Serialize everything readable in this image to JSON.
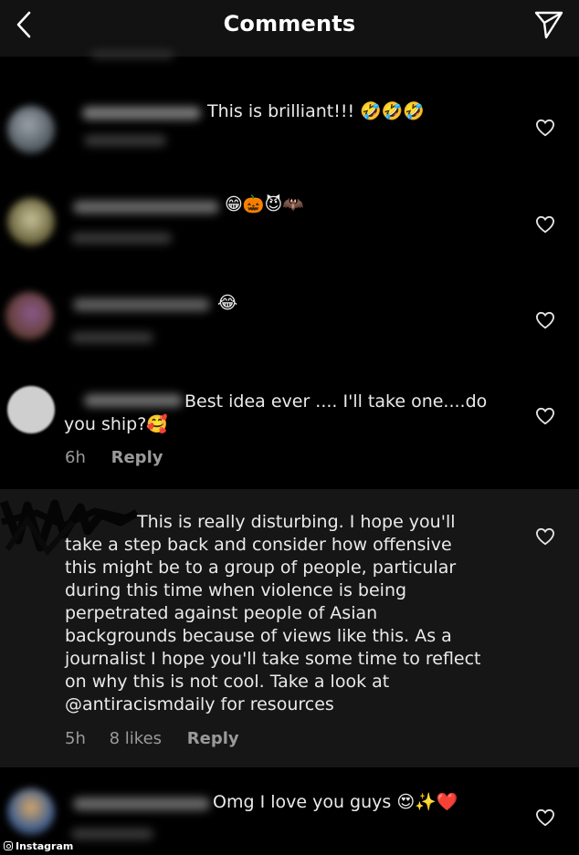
{
  "header": {
    "title": "Comments",
    "back_icon": "chevron-left-icon",
    "share_icon": "paper-plane-icon"
  },
  "comments": [
    {
      "text_lines": [
        "This is brilliant!!! 🤣🤣🤣"
      ],
      "time": "",
      "likes": "",
      "reply": ""
    },
    {
      "text_lines": [
        "😁🎃😈🦇"
      ],
      "time": "",
      "likes": "",
      "reply": ""
    },
    {
      "text_lines": [
        "😂"
      ],
      "time": "",
      "likes": "",
      "reply": ""
    },
    {
      "text_lines": [
        "Best idea ever .... I'll take one....do",
        "you ship?🥰"
      ],
      "time": "6h",
      "likes": "",
      "reply": "Reply"
    },
    {
      "text_lines": [
        "This is really disturbing. I hope you'll",
        "take a step back and consider how offensive",
        "this might be to a group of people, particular",
        "during this time when violence is being",
        "perpetrated against people of Asian",
        "backgrounds because of views like this. As a",
        "journalist I hope you'll take some time to reflect",
        "on why this is not cool. Take a look at",
        "@antiracismdaily for resources"
      ],
      "time": "5h",
      "likes": "8 likes",
      "reply": "Reply"
    },
    {
      "text_lines": [
        "Omg I love you guys 😍✨❤️"
      ],
      "time": "",
      "likes": "",
      "reply": ""
    }
  ],
  "credit": "Instagram",
  "colors": {
    "background": "#000000",
    "header": "#121212",
    "highlight_row": "#161616",
    "muted_text": "#9a9a9a"
  }
}
